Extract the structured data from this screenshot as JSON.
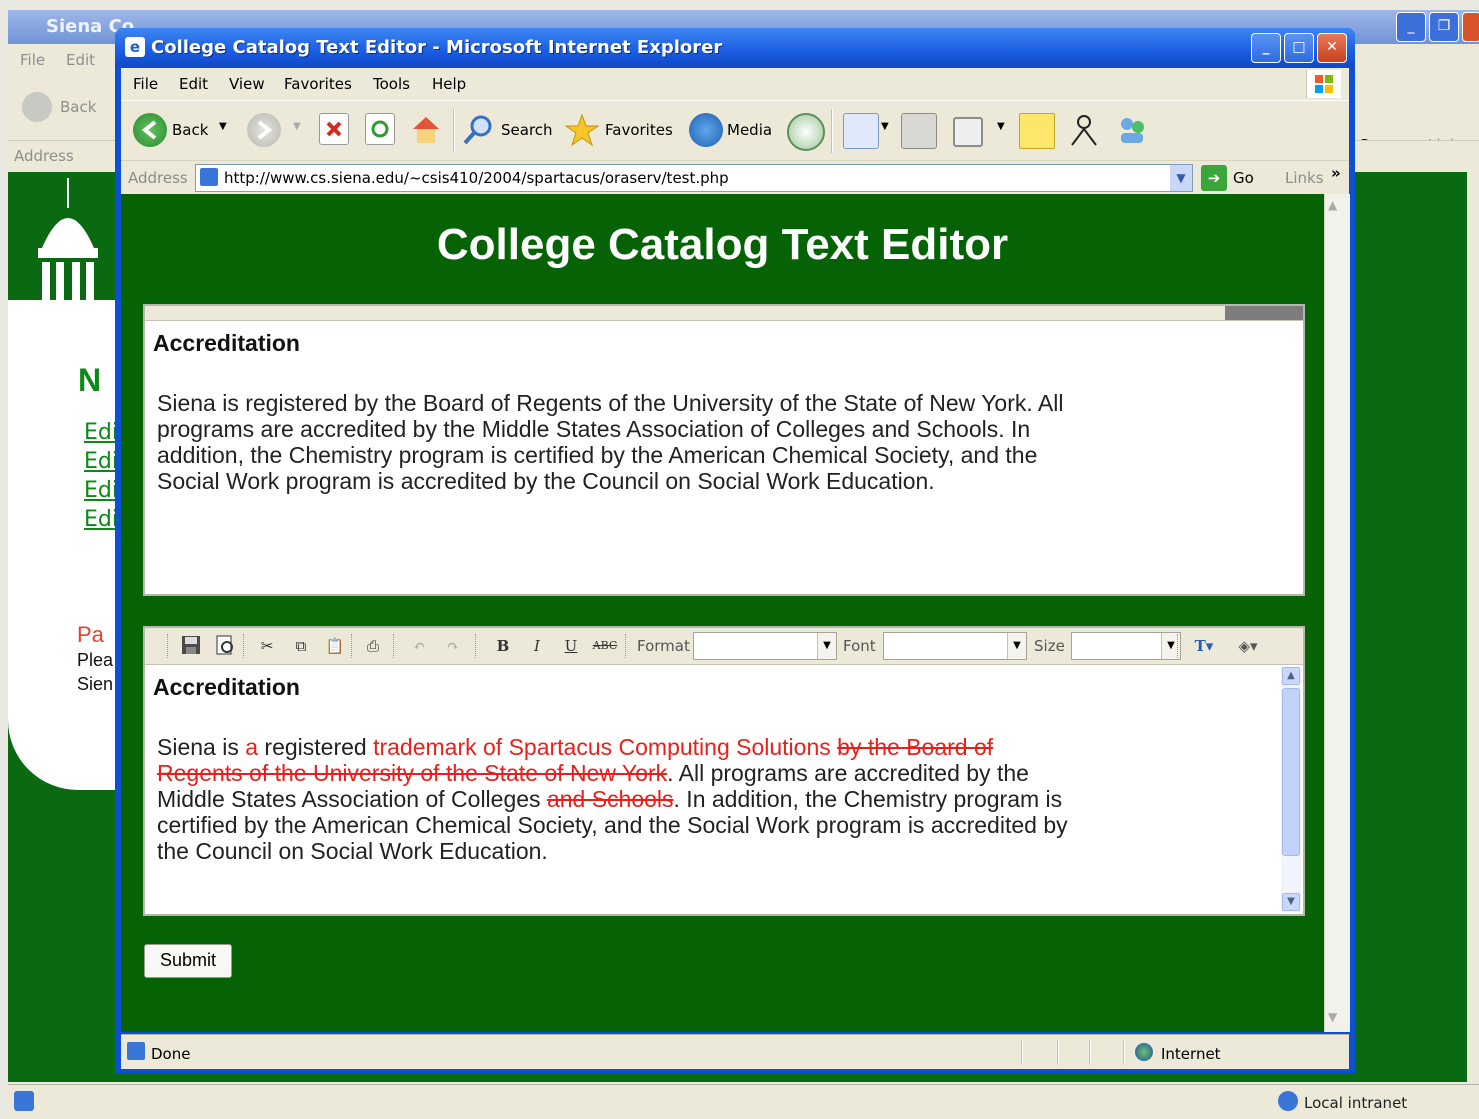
{
  "back_window": {
    "title": "Siena Co",
    "menu": [
      "File",
      "Edit"
    ],
    "back_label": "Back",
    "address_label": "Address",
    "go_label": "Go",
    "links_label": "Links",
    "heading_fragment": "N",
    "links": [
      "Edi",
      "Edi",
      "Edi",
      "Edi"
    ],
    "para_fragments": [
      "Pa",
      "Plea",
      "Sien"
    ],
    "status_zone": "Local intranet"
  },
  "window": {
    "title": "College Catalog Text Editor - Microsoft Internet Explorer"
  },
  "menubar": [
    "File",
    "Edit",
    "View",
    "Favorites",
    "Tools",
    "Help"
  ],
  "toolbar": {
    "back_label": "Back",
    "search_label": "Search",
    "favorites_label": "Favorites",
    "media_label": "Media"
  },
  "addressbar": {
    "label": "Address",
    "url": "http://www.cs.siena.edu/~csis410/2004/spartacus/oraserv/test.php",
    "go_label": "Go",
    "links_label": "Links"
  },
  "page": {
    "title": "College Catalog Text Editor",
    "preview": {
      "heading": "Accreditation",
      "body": "Siena is registered by the Board of Regents of the University of the State of New York. All programs are accredited by the Middle States Association of Colleges and Schools. In addition, the Chemistry program is certified by the American Chemical Society, and the Social Work program is accredited by the Council on Social Work Education."
    },
    "editor": {
      "toolbar": {
        "format_label": "Format",
        "font_label": "Font",
        "size_label": "Size",
        "bold": "B",
        "italic": "I",
        "underline": "U",
        "strike": "ABC"
      },
      "heading": "Accreditation",
      "segments": {
        "s1": "Siena is ",
        "s2": "a",
        "s3": " registered ",
        "s4": "trademark of Spartacus Computing Solutions",
        "s5": " ",
        "s6": "by the Board of Regents of the University of the State of New York",
        "s7": ". All programs are accredited by the Middle States Association of Colleges ",
        "s8": "and Schools",
        "s9": ". In addition, the Chemistry program is certified by the American Chemical Society, and the Social Work program is accredited by the Council on Social Work Education."
      }
    },
    "submit_label": "Submit"
  },
  "statusbar": {
    "status": "Done",
    "zone": "Internet"
  },
  "colors": {
    "page_green": "#056305",
    "inserted_text": "#e8201b",
    "deleted_text": "#e8201b",
    "title_blue": "#1a5ce0"
  }
}
